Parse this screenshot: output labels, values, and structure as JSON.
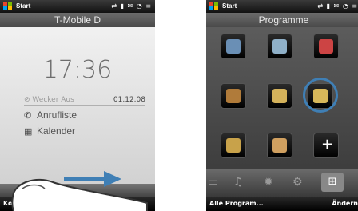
{
  "left": {
    "status_start": "Start",
    "title": "T-Mobile D",
    "clock": "17:36",
    "alarm_label": "Wecker Aus",
    "date": "01.12.08",
    "menu_items": [
      {
        "label": "Anrufliste",
        "icon": "phone-icon"
      },
      {
        "label": "Kalender",
        "icon": "calendar-icon"
      }
    ],
    "softkey_left": "Kontakte"
  },
  "right": {
    "status_start": "Start",
    "title": "Programme",
    "softkey_left": "Alle Program...",
    "softkey_right": "Ändern",
    "apps": [
      {
        "icon": "keyboard-icon",
        "color": "#6a8fb5"
      },
      {
        "icon": "phone-device-icon",
        "color": "#8fb0c8"
      },
      {
        "icon": "message-icon",
        "color": "#c44"
      },
      {
        "icon": "notes-icon",
        "color": "#b07b3a"
      },
      {
        "icon": "folder-icon",
        "color": "#d4b25b"
      },
      {
        "icon": "explorer-icon",
        "color": "#d8b85a"
      },
      {
        "icon": "games-icon",
        "color": "#c8a24a"
      },
      {
        "icon": "maps-icon",
        "color": "#d0a060"
      },
      {
        "icon": "plus-icon",
        "color": "#888"
      }
    ],
    "tab_icons": [
      "photo-icon",
      "music-icon",
      "weather-icon",
      "settings-icon",
      "grid-icon"
    ]
  }
}
